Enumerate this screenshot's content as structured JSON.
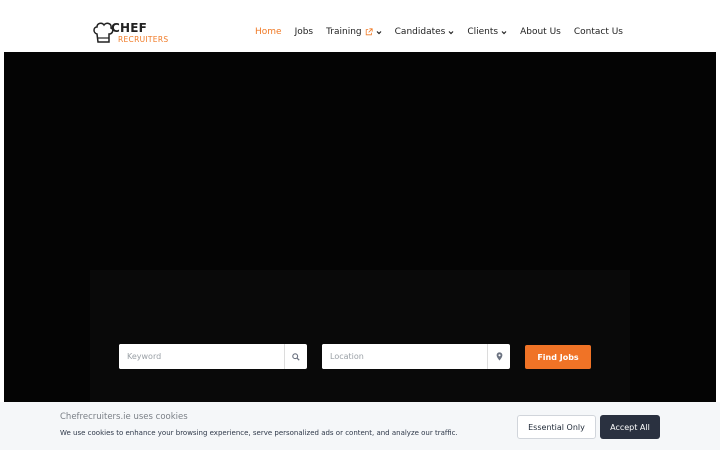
{
  "header": {
    "logo": {
      "line1": "CHEF",
      "line2": "RECRUITERS",
      "accent_color": "#f07a26"
    },
    "nav": [
      {
        "label": "Home",
        "active": true
      },
      {
        "label": "Jobs"
      },
      {
        "label": "Training",
        "external": true,
        "dropdown": true
      },
      {
        "label": "Candidates",
        "dropdown": true
      },
      {
        "label": "Clients",
        "dropdown": true
      },
      {
        "label": "About Us"
      },
      {
        "label": "Contact Us"
      }
    ]
  },
  "search": {
    "keyword_placeholder": "Keyword",
    "keyword_icon": "search-icon",
    "location_placeholder": "Location",
    "location_icon": "map-pin-icon",
    "find_button": "Find Jobs",
    "button_color": "#f07326"
  },
  "cookie_banner": {
    "title": "Chefrecruiters.ie uses cookies",
    "text": "We use cookies to enhance your browsing experience, serve personalized ads or content, and analyze our traffic.",
    "essential_label": "Essential Only",
    "accept_label": "Accept All"
  }
}
